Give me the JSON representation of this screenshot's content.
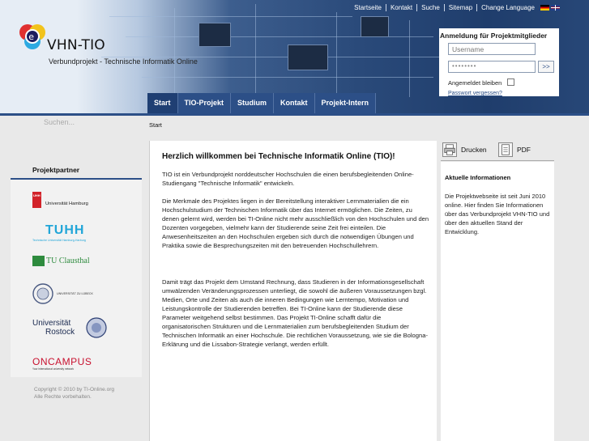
{
  "header": {
    "logo_title": "VHN-TIO",
    "logo_subtitle": "Verbundprojekt - Technische Informatik Online",
    "top_links": [
      "Startseite",
      "Kontakt",
      "Suche",
      "Sitemap",
      "Change Language"
    ]
  },
  "login": {
    "title": "Anmeldung für Projektmitglieder",
    "username_placeholder": "Username",
    "password_value": "••••••••",
    "submit_label": ">>",
    "remember_label": "Angemeldet bleiben",
    "forgot_label": "Passwort vergessen?"
  },
  "main_nav": [
    "Start",
    "TIO-Projekt",
    "Studium",
    "Kontakt",
    "Projekt-Intern"
  ],
  "active_nav": "Start",
  "search": {
    "placeholder": "Suchen..."
  },
  "breadcrumb": "Start",
  "partners": {
    "title": "Projektpartner",
    "items": [
      {
        "name": "Universität Hamburg",
        "small": "UHH"
      },
      {
        "name": "TUHH",
        "sub": "Technische Universität Hamburg-Harburg"
      },
      {
        "name": "TU Clausthal"
      },
      {
        "name": "UNIVERSITÄT ZU LÜBECK"
      },
      {
        "name": "Universität Rostock",
        "line1": "Universität",
        "line2": "Rostock"
      },
      {
        "name": "ONCAMPUS",
        "sub": "Your international university network"
      }
    ]
  },
  "copyright": [
    "Copyright © 2010 by TI-Online.org",
    "Alle Rechte vorbehalten."
  ],
  "content": {
    "title": "Herzlich willkommen bei Technische Informatik Online (TIO)!",
    "paragraphs": [
      "TIO ist ein Verbundprojekt norddeutscher Hochschulen die einen berufsbegleitenden Online-Studiengang \"Technische Informatik\" entwickeln.",
      "Die Merkmale des Projektes liegen in der Bereitstellung interaktiver Lernmaterialien die ein Hochschulstudium der Technischen Informatik über das Internet ermöglichen. Die Zeiten, zu denen gelernt wird, werden bei TI-Online nicht mehr ausschließlich von den Hochschulen und den Dozenten vorgegeben, vielmehr kann der Studierende seine Zeit frei einteilen. Die Anwesenheitszeiten an den Hochschulen ergeben sich durch die notwendigen Übungen und Praktika sowie die Besprechungszeiten mit den betreuenden Hochschullehrern.",
      "Damit trägt das Projekt dem Umstand Rechnung, dass Studieren in der Informationsgesellschaft umwälzenden Veränderungsprozessen unterliegt, die sowohl die äußeren Voraussetzungen bzgl. Medien, Orte und Zeiten als auch die inneren Bedingungen wie Lerntempo, Motivation und Leistungskontrolle der Studierenden betreffen. Bei TI-Online kann der Studierende diese Parameter weitgehend selbst bestimmen. Das Projekt TI-Online schafft dafür die organisatorischen Strukturen und die Lernmaterialien zum berufsbegleitenden Studium der Technischen Informatik an einer Hochschule. Die rechtlichen Voraussetzung, wie sie die Bologna-Erklärung und die Lissabon-Strategie verlangt, werden erfüllt."
    ]
  },
  "tools": {
    "print_label": "Drucken",
    "pdf_label": "PDF"
  },
  "sidebar": {
    "title": "Aktuelle Informationen",
    "text": "Die Projektwebseite ist seit Juni 2010 online. Hier finden Sie Informationen über das Verbundprojekt VHN-TIO und über den aktuellen Stand der Entwicklung."
  },
  "colors": {
    "nav_blue": "#2c4f87",
    "nav_active": "#1f3f73",
    "uhh_red": "#d2232a",
    "tuhh_cyan": "#22a6d8",
    "clausthal_green": "#2e8b3e",
    "oncampus_red": "#c8102e"
  }
}
